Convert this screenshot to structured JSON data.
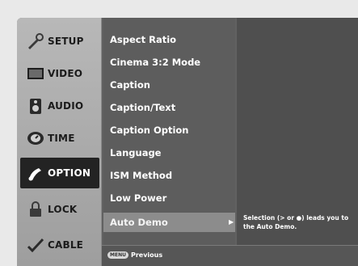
{
  "sidebar": {
    "items": [
      {
        "label": "SETUP",
        "icon": "setup-icon",
        "active": false
      },
      {
        "label": "VIDEO",
        "icon": "video-icon",
        "active": false
      },
      {
        "label": "AUDIO",
        "icon": "audio-icon",
        "active": false
      },
      {
        "label": "TIME",
        "icon": "time-icon",
        "active": false
      },
      {
        "label": "OPTION",
        "icon": "option-icon",
        "active": true
      },
      {
        "label": "LOCK",
        "icon": "lock-icon",
        "active": false
      },
      {
        "label": "CABLE",
        "icon": "cable-icon",
        "active": false
      }
    ]
  },
  "menu": {
    "items": [
      "Aspect Ratio",
      "Cinema 3:2 Mode",
      "Caption",
      "Caption/Text",
      "Caption Option",
      "Language",
      "ISM Method",
      "Low Power",
      "Auto Demo"
    ],
    "selected_index": 8,
    "arrow": "▶"
  },
  "help_text": "Selection (> or ●) leads you to the Auto Demo.",
  "footer": {
    "key_label": "MENU",
    "previous_label": "Previous"
  },
  "colors": {
    "frame": "#616161",
    "active_bg": "#232323",
    "selected_bg": "#8c8c8c"
  }
}
